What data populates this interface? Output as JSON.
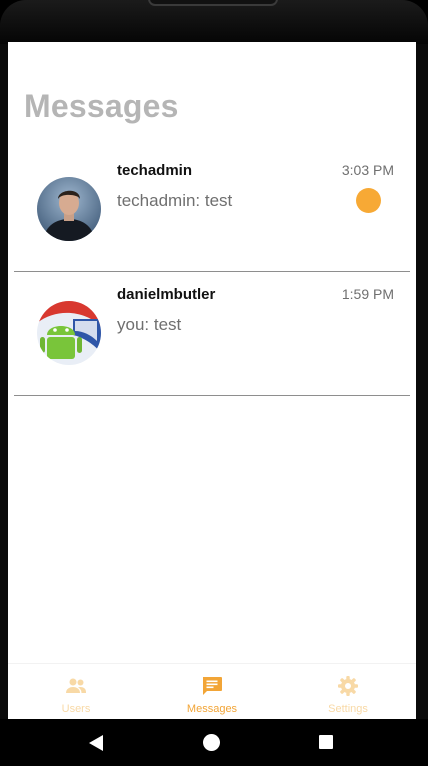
{
  "page_title": "Messages",
  "conversations": [
    {
      "name": "techadmin",
      "time": "3:03 PM",
      "preview": "techadmin: test",
      "unread": true,
      "avatar": "person-photo"
    },
    {
      "name": "danielmbutler",
      "time": "1:59 PM",
      "preview": "you: test",
      "unread": false,
      "avatar": "android-robot"
    }
  ],
  "bottom_nav": {
    "items": [
      {
        "label": "Users",
        "icon": "users-icon",
        "active": false
      },
      {
        "label": "Messages",
        "icon": "chat-bubble-icon",
        "active": true
      },
      {
        "label": "Settings",
        "icon": "gear-icon",
        "active": false
      }
    ]
  },
  "system_nav": [
    "back",
    "home",
    "recents"
  ],
  "colors": {
    "accent": "#f2a537",
    "accent_inactive": "#f8d9a6",
    "unread_dot": "#f7a935",
    "title_gray": "#b5b5b5",
    "divider": "#8e8e8e"
  }
}
